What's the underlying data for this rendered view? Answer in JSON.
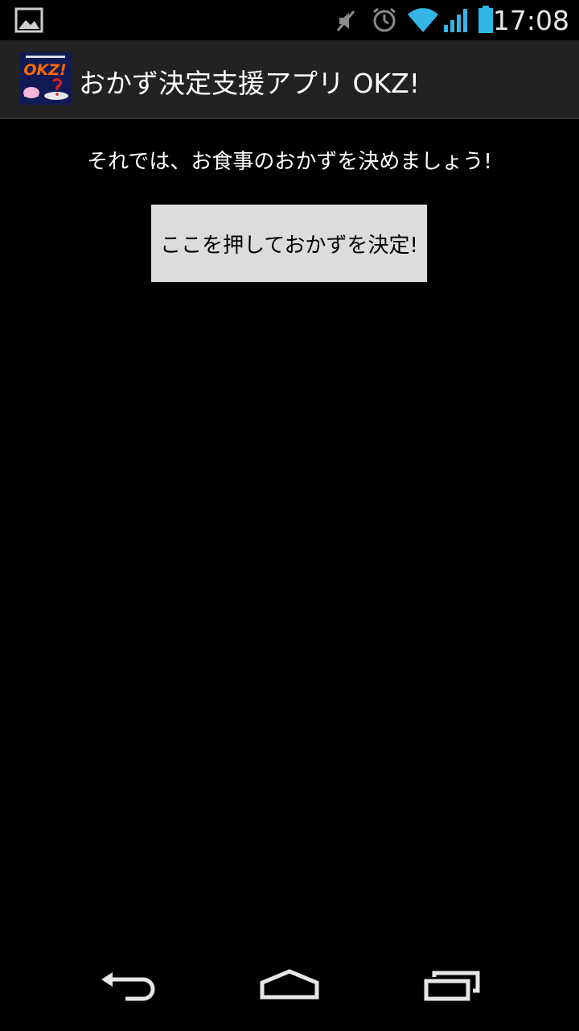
{
  "status_bar": {
    "time": "17:08",
    "icons": [
      "image-notification-icon",
      "mute-icon",
      "alarm-icon",
      "wifi-icon",
      "cell-signal-icon",
      "battery-icon"
    ]
  },
  "action_bar": {
    "app_icon": "okz-app-icon",
    "app_icon_text": "OKZ!",
    "title": "おかず決定支援アプリ OKZ!"
  },
  "main": {
    "prompt": "それでは、お食事のおかずを決めましょう!",
    "decide_button_label": "ここを押しておかずを決定!"
  },
  "nav_bar": {
    "icons": [
      "back-icon",
      "home-icon",
      "recent-apps-icon"
    ]
  },
  "colors": {
    "background": "#000000",
    "action_bar": "#222222",
    "button": "#dcdcdc",
    "status_accent": "#33b5e5"
  }
}
